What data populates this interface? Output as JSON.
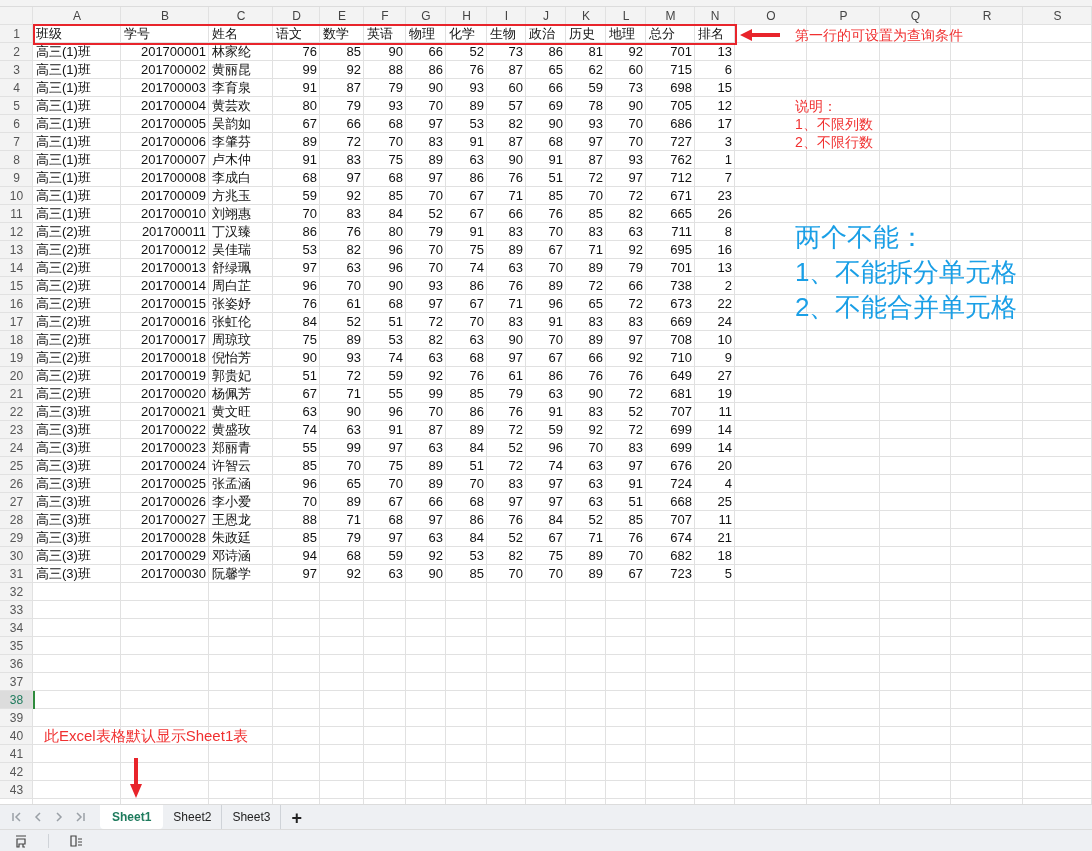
{
  "columns": [
    {
      "label": "A",
      "numeric": false
    },
    {
      "label": "B",
      "numeric": true
    },
    {
      "label": "C",
      "numeric": false
    },
    {
      "label": "D",
      "numeric": true
    },
    {
      "label": "E",
      "numeric": true
    },
    {
      "label": "F",
      "numeric": true
    },
    {
      "label": "G",
      "numeric": true
    },
    {
      "label": "H",
      "numeric": true
    },
    {
      "label": "I",
      "numeric": true
    },
    {
      "label": "J",
      "numeric": true
    },
    {
      "label": "K",
      "numeric": true
    },
    {
      "label": "L",
      "numeric": true
    },
    {
      "label": "M",
      "numeric": true
    },
    {
      "label": "N",
      "numeric": true
    },
    {
      "label": "O"
    },
    {
      "label": "P"
    },
    {
      "label": "Q"
    },
    {
      "label": "R"
    },
    {
      "label": "S"
    }
  ],
  "row_headers": [
    {
      "label": "1",
      "selected": false
    },
    {
      "label": "2",
      "selected": false
    },
    {
      "label": "3",
      "selected": false
    },
    {
      "label": "4",
      "selected": false
    },
    {
      "label": "5",
      "selected": false
    },
    {
      "label": "6",
      "selected": false
    },
    {
      "label": "7",
      "selected": false
    },
    {
      "label": "8",
      "selected": false
    },
    {
      "label": "9",
      "selected": false
    },
    {
      "label": "10",
      "selected": false
    },
    {
      "label": "11",
      "selected": false
    },
    {
      "label": "12",
      "selected": false
    },
    {
      "label": "13",
      "selected": false
    },
    {
      "label": "14",
      "selected": false
    },
    {
      "label": "15",
      "selected": false
    },
    {
      "label": "16",
      "selected": false
    },
    {
      "label": "17",
      "selected": false
    },
    {
      "label": "18",
      "selected": false
    },
    {
      "label": "19",
      "selected": false
    },
    {
      "label": "20",
      "selected": false
    },
    {
      "label": "21",
      "selected": false
    },
    {
      "label": "22",
      "selected": false
    },
    {
      "label": "23",
      "selected": false
    },
    {
      "label": "24",
      "selected": false
    },
    {
      "label": "25",
      "selected": false
    },
    {
      "label": "26",
      "selected": false
    },
    {
      "label": "27",
      "selected": false
    },
    {
      "label": "28",
      "selected": false
    },
    {
      "label": "29",
      "selected": false
    },
    {
      "label": "30",
      "selected": false
    },
    {
      "label": "31",
      "selected": false
    },
    {
      "label": "32",
      "selected": false
    },
    {
      "label": "33",
      "selected": false
    },
    {
      "label": "34",
      "selected": false
    },
    {
      "label": "35",
      "selected": false
    },
    {
      "label": "36",
      "selected": false
    },
    {
      "label": "37",
      "selected": false
    },
    {
      "label": "38",
      "selected": true
    },
    {
      "label": "39",
      "selected": false
    },
    {
      "label": "40",
      "selected": false
    },
    {
      "label": "41",
      "selected": false
    },
    {
      "label": "42",
      "selected": false
    },
    {
      "label": "43",
      "selected": false
    }
  ],
  "rows": [
    [
      "班级",
      "学号",
      "姓名",
      "语文",
      "数学",
      "英语",
      "物理",
      "化学",
      "生物",
      "政治",
      "历史",
      "地理",
      "总分",
      "排名"
    ],
    [
      "高三(1)班",
      "201700001",
      "林家纶",
      "76",
      "85",
      "90",
      "66",
      "52",
      "73",
      "86",
      "81",
      "92",
      "701",
      "13"
    ],
    [
      "高三(1)班",
      "201700002",
      "黄丽昆",
      "99",
      "92",
      "88",
      "86",
      "76",
      "87",
      "65",
      "62",
      "60",
      "715",
      "6"
    ],
    [
      "高三(1)班",
      "201700003",
      "李育泉",
      "91",
      "87",
      "79",
      "90",
      "93",
      "60",
      "66",
      "59",
      "73",
      "698",
      "15"
    ],
    [
      "高三(1)班",
      "201700004",
      "黄芸欢",
      "80",
      "79",
      "93",
      "70",
      "89",
      "57",
      "69",
      "78",
      "90",
      "705",
      "12"
    ],
    [
      "高三(1)班",
      "201700005",
      "吴韵如",
      "67",
      "66",
      "68",
      "97",
      "53",
      "82",
      "90",
      "93",
      "70",
      "686",
      "17"
    ],
    [
      "高三(1)班",
      "201700006",
      "李肇芬",
      "89",
      "72",
      "70",
      "83",
      "91",
      "87",
      "68",
      "97",
      "70",
      "727",
      "3"
    ],
    [
      "高三(1)班",
      "201700007",
      "卢木仲",
      "91",
      "83",
      "75",
      "89",
      "63",
      "90",
      "91",
      "87",
      "93",
      "762",
      "1"
    ],
    [
      "高三(1)班",
      "201700008",
      "李成白",
      "68",
      "97",
      "68",
      "97",
      "86",
      "76",
      "51",
      "72",
      "97",
      "712",
      "7"
    ],
    [
      "高三(1)班",
      "201700009",
      "方兆玉",
      "59",
      "92",
      "85",
      "70",
      "67",
      "71",
      "85",
      "70",
      "72",
      "671",
      "23"
    ],
    [
      "高三(1)班",
      "201700010",
      "刘翊惠",
      "70",
      "83",
      "84",
      "52",
      "67",
      "66",
      "76",
      "85",
      "82",
      "665",
      "26"
    ],
    [
      "高三(2)班",
      "201700011",
      "丁汉臻",
      "86",
      "76",
      "80",
      "79",
      "91",
      "83",
      "70",
      "83",
      "63",
      "711",
      "8"
    ],
    [
      "高三(2)班",
      "201700012",
      "吴佳瑞",
      "53",
      "82",
      "96",
      "70",
      "75",
      "89",
      "67",
      "71",
      "92",
      "695",
      "16"
    ],
    [
      "高三(2)班",
      "201700013",
      "舒绿珮",
      "97",
      "63",
      "96",
      "70",
      "74",
      "63",
      "70",
      "89",
      "79",
      "701",
      "13"
    ],
    [
      "高三(2)班",
      "201700014",
      "周白芷",
      "96",
      "70",
      "90",
      "93",
      "86",
      "76",
      "89",
      "72",
      "66",
      "738",
      "2"
    ],
    [
      "高三(2)班",
      "201700015",
      "张姿妤",
      "76",
      "61",
      "68",
      "97",
      "67",
      "71",
      "96",
      "65",
      "72",
      "673",
      "22"
    ],
    [
      "高三(2)班",
      "201700016",
      "张虹伦",
      "84",
      "52",
      "51",
      "72",
      "70",
      "83",
      "91",
      "83",
      "83",
      "669",
      "24"
    ],
    [
      "高三(2)班",
      "201700017",
      "周琼玟",
      "75",
      "89",
      "53",
      "82",
      "63",
      "90",
      "70",
      "89",
      "97",
      "708",
      "10"
    ],
    [
      "高三(2)班",
      "201700018",
      "倪怡芳",
      "90",
      "93",
      "74",
      "63",
      "68",
      "97",
      "67",
      "66",
      "92",
      "710",
      "9"
    ],
    [
      "高三(2)班",
      "201700019",
      "郭贵妃",
      "51",
      "72",
      "59",
      "92",
      "76",
      "61",
      "86",
      "76",
      "76",
      "649",
      "27"
    ],
    [
      "高三(2)班",
      "201700020",
      "杨佩芳",
      "67",
      "71",
      "55",
      "99",
      "85",
      "79",
      "63",
      "90",
      "72",
      "681",
      "19"
    ],
    [
      "高三(3)班",
      "201700021",
      "黄文旺",
      "63",
      "90",
      "96",
      "70",
      "86",
      "76",
      "91",
      "83",
      "52",
      "707",
      "11"
    ],
    [
      "高三(3)班",
      "201700022",
      "黄盛玫",
      "74",
      "63",
      "91",
      "87",
      "89",
      "72",
      "59",
      "92",
      "72",
      "699",
      "14"
    ],
    [
      "高三(3)班",
      "201700023",
      "郑丽青",
      "55",
      "99",
      "97",
      "63",
      "84",
      "52",
      "96",
      "70",
      "83",
      "699",
      "14"
    ],
    [
      "高三(3)班",
      "201700024",
      "许智云",
      "85",
      "70",
      "75",
      "89",
      "51",
      "72",
      "74",
      "63",
      "97",
      "676",
      "20"
    ],
    [
      "高三(3)班",
      "201700025",
      "张孟涵",
      "96",
      "65",
      "70",
      "89",
      "70",
      "83",
      "97",
      "63",
      "91",
      "724",
      "4"
    ],
    [
      "高三(3)班",
      "201700026",
      "李小爱",
      "70",
      "89",
      "67",
      "66",
      "68",
      "97",
      "97",
      "63",
      "51",
      "668",
      "25"
    ],
    [
      "高三(3)班",
      "201700027",
      "王恩龙",
      "88",
      "71",
      "68",
      "97",
      "86",
      "76",
      "84",
      "52",
      "85",
      "707",
      "11"
    ],
    [
      "高三(3)班",
      "201700028",
      "朱政廷",
      "85",
      "79",
      "97",
      "63",
      "84",
      "52",
      "67",
      "71",
      "76",
      "674",
      "21"
    ],
    [
      "高三(3)班",
      "201700029",
      "邓诗涵",
      "94",
      "68",
      "59",
      "92",
      "53",
      "82",
      "75",
      "89",
      "70",
      "682",
      "18"
    ],
    [
      "高三(3)班",
      "201700030",
      "阮馨学",
      "97",
      "92",
      "63",
      "90",
      "85",
      "70",
      "70",
      "89",
      "67",
      "723",
      "5"
    ]
  ],
  "annotations": [
    {
      "kind": "header_note",
      "lines": [
        "第一行的可设置为查询条件"
      ]
    },
    {
      "kind": "notes",
      "lines": [
        "说明：",
        "1、不限列数",
        "2、不限行数"
      ]
    },
    {
      "kind": "rules",
      "lines": [
        "两个不能：",
        "1、不能拆分单元格",
        "2、不能合并单元格"
      ]
    },
    {
      "kind": "sheet_note",
      "lines": [
        "此Excel表格默认显示Sheet1表"
      ]
    }
  ],
  "sheet_tabs": [
    {
      "label": "Sheet1",
      "selected": true
    },
    {
      "label": "Sheet2",
      "selected": false
    },
    {
      "label": "Sheet3",
      "selected": false
    }
  ],
  "add_sheet": "+"
}
